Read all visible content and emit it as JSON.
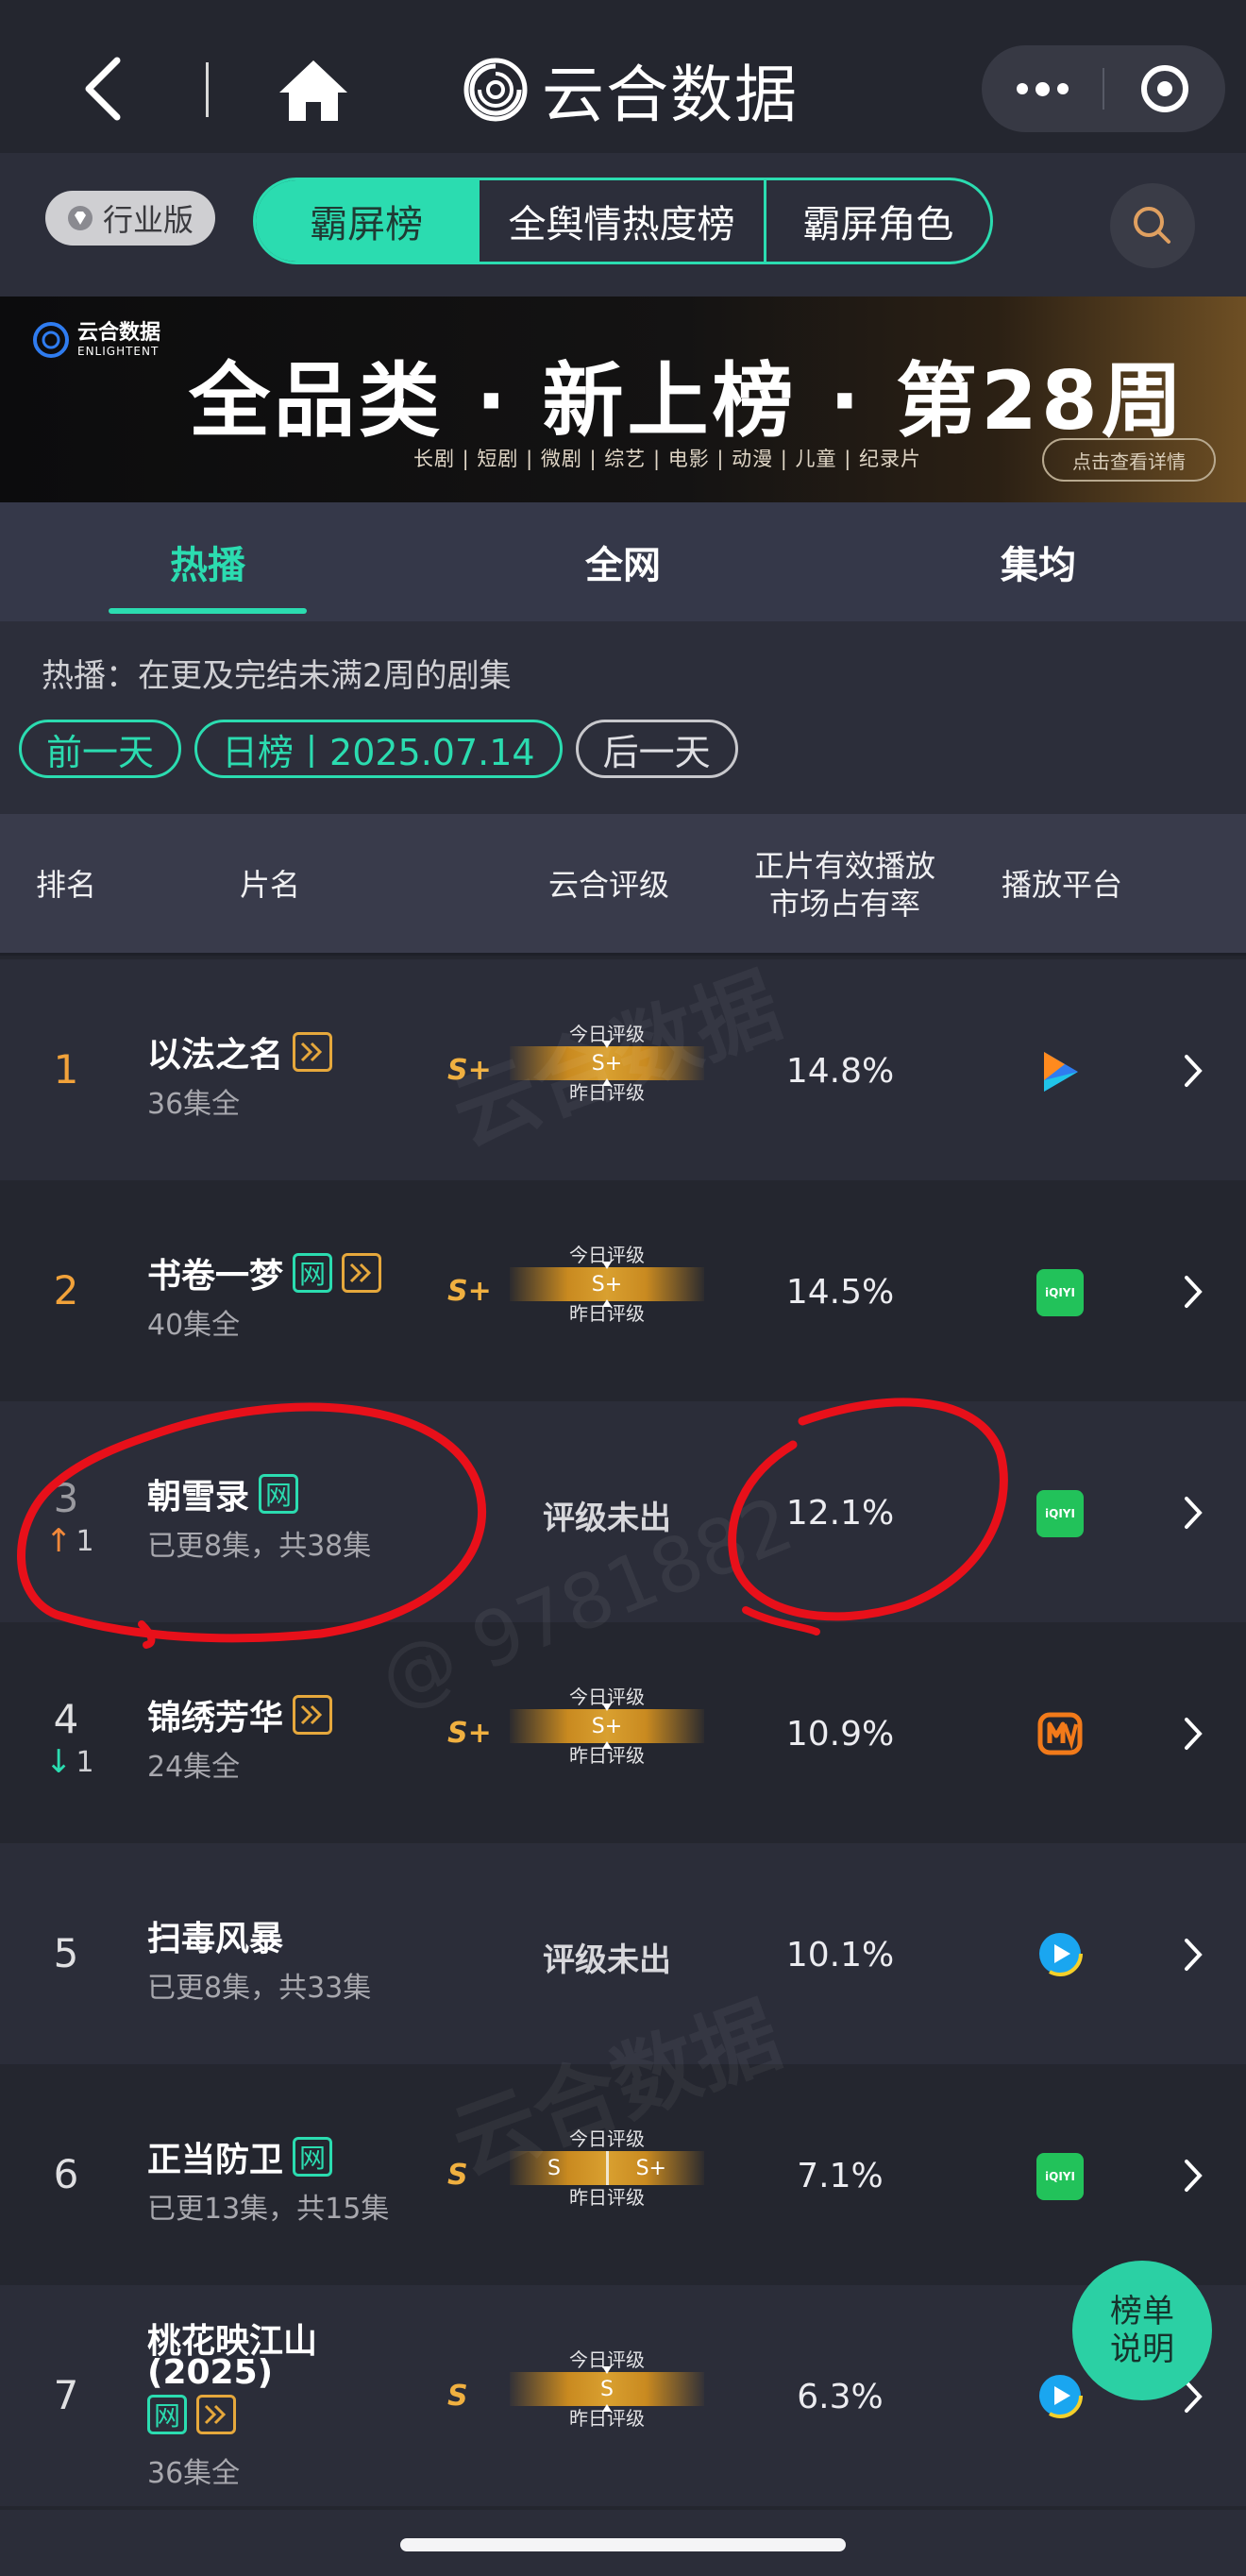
{
  "topbar": {
    "brand_title": "云合数据"
  },
  "tabs": {
    "industry_badge": "行业版",
    "items": [
      "霸屏榜",
      "全舆情热度榜",
      "霸屏角色"
    ],
    "active": "霸屏榜"
  },
  "banner": {
    "logo_cn": "云合数据",
    "logo_en": "ENLIGHTENT",
    "title": "全品类 · 新上榜 · 第28周",
    "categories": "长剧 | 短剧 | 微剧 | 综艺 | 电影 | 动漫 | 儿童 | 纪录片",
    "detail_button": "点击查看详情"
  },
  "subtabs": [
    "热播",
    "全网",
    "集均"
  ],
  "info": {
    "description": "热播：在更及完结未满2周的剧集",
    "prev_day": "前一天",
    "date_label": "日榜丨2025.07.14",
    "next_day": "后一天"
  },
  "table": {
    "headers": {
      "rank": "排名",
      "title": "片名",
      "rating": "云合评级",
      "share_line1": "正片有效播放",
      "share_line2": "市场占有率",
      "platform": "播放平台"
    },
    "rating_today_label": "今日评级",
    "rating_yesterday_label": "昨日评级",
    "rating_pending": "评级未出",
    "rows": [
      {
        "rank": "1",
        "title": "以法之名",
        "tags": [
          "play"
        ],
        "episodes": "36集全",
        "grade": "S+",
        "grade_today": "S+",
        "grade_yesterday": "",
        "share": "14.8%",
        "platform": "tencent-video-icon",
        "trend": ""
      },
      {
        "rank": "2",
        "title": "书卷一梦",
        "tags": [
          "net",
          "play"
        ],
        "episodes": "40集全",
        "grade": "S+",
        "grade_today": "S+",
        "grade_yesterday": "",
        "share": "14.5%",
        "platform": "iqiyi-icon",
        "trend": ""
      },
      {
        "rank": "3",
        "title": "朝雪录",
        "tags": [
          "net"
        ],
        "episodes": "已更8集，共38集",
        "grade": "",
        "share": "12.1%",
        "platform": "iqiyi-icon",
        "trend": "1",
        "trend_dir": "up"
      },
      {
        "rank": "4",
        "title": "锦绣芳华",
        "tags": [
          "play"
        ],
        "episodes": "24集全",
        "grade": "S+",
        "grade_today": "S+",
        "grade_yesterday": "",
        "share": "10.9%",
        "platform": "mango-tv-icon",
        "trend": "1",
        "trend_dir": "down"
      },
      {
        "rank": "5",
        "title": "扫毒风暴",
        "tags": [],
        "episodes": "已更8集，共33集",
        "grade": "",
        "share": "10.1%",
        "platform": "youku-icon",
        "trend": ""
      },
      {
        "rank": "6",
        "title": "正当防卫",
        "tags": [
          "net"
        ],
        "episodes": "已更13集，共15集",
        "grade": "S",
        "grade_today": "S",
        "grade_yesterday": "S+",
        "share": "7.1%",
        "platform": "iqiyi-icon",
        "trend": ""
      },
      {
        "rank": "7",
        "title": "桃花映江山",
        "title_line2": "(2025)",
        "tags": [
          "net",
          "play"
        ],
        "episodes": "36集全",
        "grade": "S",
        "grade_today": "S",
        "grade_yesterday": "",
        "share": "6.3%",
        "platform": "youku-icon",
        "trend": ""
      }
    ],
    "net_tag": "网",
    "iqiyi_text": "iQIYI"
  },
  "watermark": {
    "brand": "云合数据",
    "brand_en": "ENLIGHTENT",
    "uid": "@ 9781882"
  },
  "help_fab": {
    "line1": "榜单",
    "line2": "说明"
  },
  "colors": {
    "accent": "#2bdcb0",
    "rank_gold": "#f2a23a",
    "grade_gold": "#f0b040",
    "annotation_red": "#e8101a",
    "background": "#24262f"
  }
}
